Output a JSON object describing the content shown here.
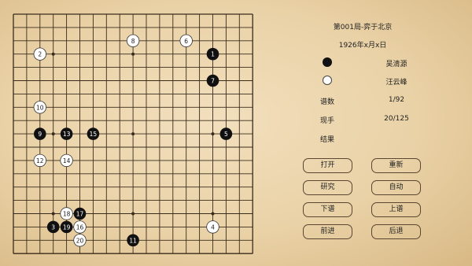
{
  "game": {
    "title": "第001局-弈于北京",
    "date": "1926年x月x日"
  },
  "players": {
    "black_icon": "black-stone",
    "black_name": "吴清源",
    "white_icon": "white-stone",
    "white_name": "汪云峰"
  },
  "stats": {
    "record_label": "谱数",
    "record_value": "1/92",
    "current_label": "现手",
    "current_value": "20/125",
    "result_label": "结果",
    "result_value": ""
  },
  "buttons": {
    "open": "打开",
    "reset": "重新",
    "study": "研究",
    "auto": "自动",
    "next_record": "下谱",
    "prev_record": "上谱",
    "forward": "前进",
    "back": "后退"
  },
  "board": {
    "size": 19,
    "stones": [
      {
        "col": 15,
        "row": 3,
        "color": "black",
        "num": "1"
      },
      {
        "col": 2,
        "row": 3,
        "color": "white",
        "num": "2"
      },
      {
        "col": 3,
        "row": 16,
        "color": "black",
        "num": "3"
      },
      {
        "col": 15,
        "row": 16,
        "color": "white",
        "num": "4"
      },
      {
        "col": 16,
        "row": 9,
        "color": "black",
        "num": "5"
      },
      {
        "col": 13,
        "row": 2,
        "color": "white",
        "num": "6"
      },
      {
        "col": 15,
        "row": 5,
        "color": "black",
        "num": "7"
      },
      {
        "col": 9,
        "row": 2,
        "color": "white",
        "num": "8"
      },
      {
        "col": 2,
        "row": 9,
        "color": "black",
        "num": "9"
      },
      {
        "col": 2,
        "row": 7,
        "color": "white",
        "num": "10"
      },
      {
        "col": 9,
        "row": 17,
        "color": "black",
        "num": "11"
      },
      {
        "col": 2,
        "row": 11,
        "color": "white",
        "num": "12"
      },
      {
        "col": 4,
        "row": 9,
        "color": "black",
        "num": "13"
      },
      {
        "col": 4,
        "row": 11,
        "color": "white",
        "num": "14"
      },
      {
        "col": 6,
        "row": 9,
        "color": "black",
        "num": "15"
      },
      {
        "col": 5,
        "row": 16,
        "color": "white",
        "num": "16"
      },
      {
        "col": 5,
        "row": 15,
        "color": "black",
        "num": "17"
      },
      {
        "col": 4,
        "row": 15,
        "color": "white",
        "num": "18"
      },
      {
        "col": 4,
        "row": 16,
        "color": "black",
        "num": "19"
      },
      {
        "col": 5,
        "row": 17,
        "color": "white",
        "num": "20"
      }
    ]
  }
}
